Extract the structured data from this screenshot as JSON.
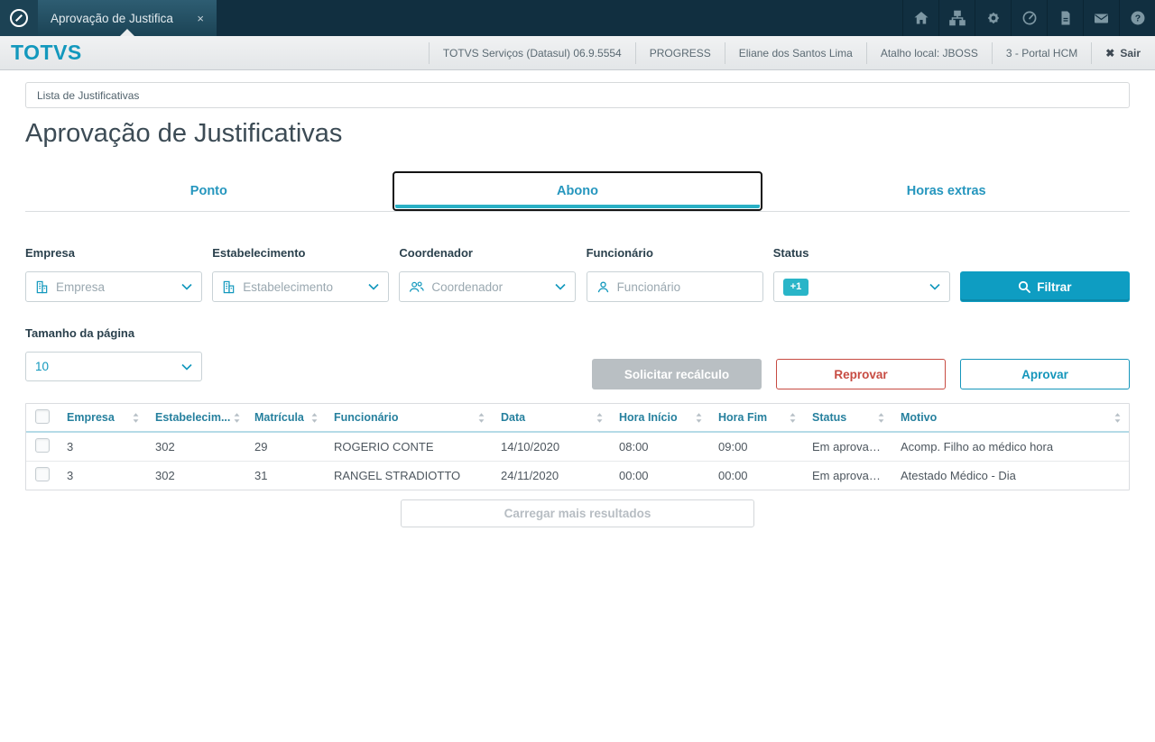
{
  "colors": {
    "accent_teal": "#0e9dc2",
    "badge_teal": "#29b5c8",
    "danger_red": "#c74b42",
    "navbar_dark": "#112f40"
  },
  "navbar": {
    "tab_title": "Aprovação de Justifica",
    "close_icon": "×",
    "right_icons": [
      "home",
      "org-chart",
      "settings",
      "clock",
      "document",
      "mail",
      "help"
    ]
  },
  "header": {
    "brand": "TOTVS",
    "items": [
      "TOTVS Serviços (Datasul) 06.9.5554",
      "PROGRESS",
      "Eliane dos Santos Lima",
      "Atalho local: JBOSS",
      "3 - Portal HCM"
    ],
    "logout_icon": "✖",
    "logout_label": "Sair"
  },
  "breadcrumb": "Lista de Justificativas",
  "page_title": "Aprovação de Justificativas",
  "tabs": [
    {
      "label": "Ponto",
      "active": false
    },
    {
      "label": "Abono",
      "active": true
    },
    {
      "label": "Horas extras",
      "active": false
    }
  ],
  "filters": {
    "empresa": {
      "label": "Empresa",
      "placeholder": "Empresa",
      "icon": "building-icon"
    },
    "estabelecimento": {
      "label": "Estabelecimento",
      "placeholder": "Estabelecimento",
      "icon": "building-icon"
    },
    "coordenador": {
      "label": "Coordenador",
      "placeholder": "Coordenador",
      "icon": "people-icon"
    },
    "funcionario": {
      "label": "Funcionário",
      "placeholder": "Funcionário",
      "icon": "person-icon"
    },
    "status": {
      "label": "Status",
      "badge": "+1"
    },
    "filter_button": "Filtrar"
  },
  "page_size": {
    "label": "Tamanho da página",
    "value": "10"
  },
  "actions": {
    "recalc": "Solicitar recálculo",
    "reject": "Reprovar",
    "approve": "Aprovar"
  },
  "table": {
    "columns": [
      "Empresa",
      "Estabelecim...",
      "Matrícula",
      "Funcionário",
      "Data",
      "Hora Início",
      "Hora Fim",
      "Status",
      "Motivo"
    ],
    "rows": [
      {
        "empresa": "3",
        "estabelecimento": "302",
        "matricula": "29",
        "funcionario": "ROGERIO CONTE",
        "data": "14/10/2020",
        "hora_inicio": "08:00",
        "hora_fim": "09:00",
        "status": "Em aprovaçã...",
        "motivo": "Acomp. Filho ao médico hora"
      },
      {
        "empresa": "3",
        "estabelecimento": "302",
        "matricula": "31",
        "funcionario": "RANGEL STRADIOTTO",
        "data": "24/11/2020",
        "hora_inicio": "00:00",
        "hora_fim": "00:00",
        "status": "Em aprovaçã...",
        "motivo": "Atestado Médico - Dia"
      }
    ]
  },
  "load_more": "Carregar mais resultados"
}
